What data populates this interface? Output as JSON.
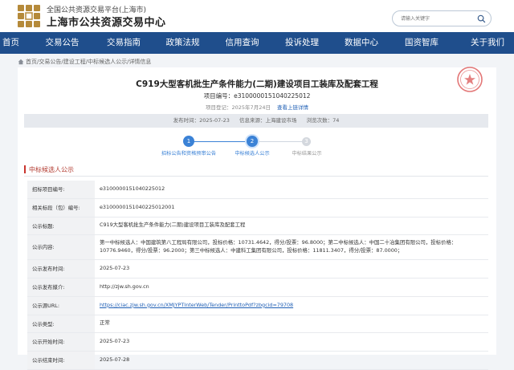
{
  "header": {
    "subtitle": "全国公共资源交易平台(上海市)",
    "title": "上海市公共资源交易中心",
    "search_placeholder": "请输入关键字"
  },
  "nav": {
    "items": [
      "首页",
      "交易公告",
      "交易指南",
      "政策法规",
      "信用查询",
      "投诉处理",
      "数据中心",
      "国资智库",
      "关于我们"
    ]
  },
  "breadcrumb": {
    "items": [
      "首页",
      "交易公告",
      "建设工程",
      "中标候选人公示",
      "详情信息"
    ],
    "separator": "/"
  },
  "article": {
    "title": "C919大型客机批生产条件能力(二期)建设项目工装库及配套工程",
    "project_no": "项目编号：e3100000151040225012",
    "time_label": "项目登记：2025年7月24日",
    "time_link": "查看上链详情",
    "publish_time": "发布时间：2025-07-23",
    "source": "信息来源：上海建设市场",
    "views": "浏览次数：74"
  },
  "steps": [
    {
      "num": "1",
      "label": "招标公告和资格预审公告",
      "state": "done"
    },
    {
      "num": "2",
      "label": "中标候选人公示",
      "state": "current"
    },
    {
      "num": "3",
      "label": "中标结果公示",
      "state": "todo"
    }
  ],
  "section": {
    "title": "中标候选人公示"
  },
  "table": [
    {
      "key": "招标项目编号:",
      "value": "e3100000151040225012"
    },
    {
      "key": "相关标段（包）编号:",
      "value": "e3100000151040225012001"
    },
    {
      "key": "公示标题:",
      "value": "C919大型客机批生产条件能力(二期)建设项目工装库及配套工程"
    },
    {
      "key": "公示内容:",
      "value": "第一中标候选人：中国建筑第八工程局有限公司，投标价格：10731.4642，得分/投票：96.8000；第二中标候选人：中国二十冶集团有限公司，投标价格：10776.9460，得分/投票：96.2000；第三中标候选人：中建科工集团有限公司，投标价格：11811.3407，得分/投票：87.0000；"
    },
    {
      "key": "公示发布时间:",
      "value": "2025-07-23"
    },
    {
      "key": "公示发布媒介:",
      "value": "http://zjw.sh.gov.cn"
    },
    {
      "key": "公示源URL:",
      "value": "https://ciac.zjw.sh.gov.cn/XMJYPTInterWeb/Tender/PrinttoPdf?zbgcid=79708",
      "link": true
    },
    {
      "key": "公示类型:",
      "value": "正常"
    },
    {
      "key": "公示开始时间:",
      "value": "2025-07-23"
    },
    {
      "key": "公示结束时间:",
      "value": "2025-07-28"
    }
  ],
  "colors": {
    "nav_bg": "#1f4e8c",
    "accent_blue": "#3b82d6",
    "section_red": "#b23a2f",
    "link": "#1f5fb5"
  }
}
